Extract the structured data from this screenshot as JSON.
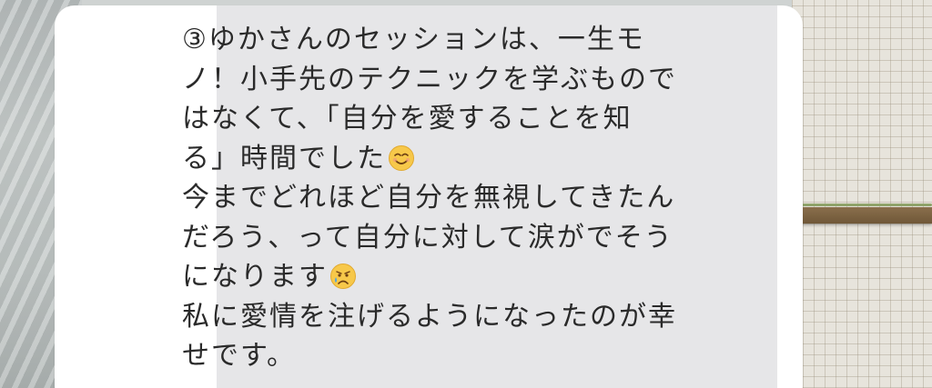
{
  "message": {
    "lines": [
      "③ゆかさんのセッションは、一生モ",
      "ノ！小手先のテクニックを学ぶもので",
      "はなくて、「自分を愛することを知",
      "る」時間でした",
      "今までどれほど自分を無視してきたん",
      "だろう、って自分に対して涙がでそう",
      "になります",
      "私に愛情を注げるようになったのが幸",
      "せです。"
    ]
  },
  "emoji": {
    "line4": "smiling-face-icon",
    "line7": "crying-face-icon"
  },
  "colors": {
    "bubble": "#ffffff",
    "text": "#2a2a2a",
    "emoji_face": "#f7c84a"
  }
}
